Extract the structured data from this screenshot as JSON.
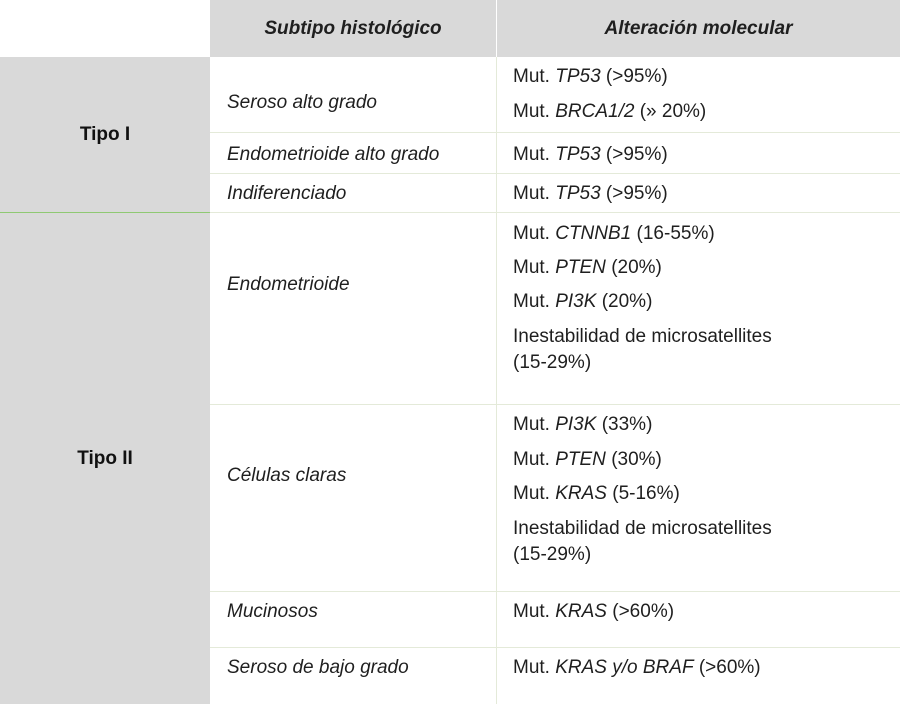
{
  "header": {
    "col_subtype": "Subtipo histológico",
    "col_alteration": "Alteración molecular"
  },
  "groups": [
    {
      "label": "Tipo I",
      "rows": [
        {
          "subtype": "Seroso alto grado",
          "alterations": [
            {
              "prefix": "Mut. ",
              "gene": "TP53",
              "suffix": " (>95%)"
            },
            {
              "prefix": "Mut. ",
              "gene": "BRCA1/2",
              "suffix": " (» 20%)"
            }
          ]
        },
        {
          "subtype": "Endometrioide alto grado",
          "alterations": [
            {
              "prefix": "Mut. ",
              "gene": "TP53",
              "suffix": " (>95%)"
            }
          ]
        },
        {
          "subtype": "Indiferenciado",
          "alterations": [
            {
              "prefix": "Mut. ",
              "gene": "TP53",
              "suffix": " (>95%)"
            }
          ]
        }
      ]
    },
    {
      "label": "Tipo II",
      "rows": [
        {
          "subtype": "Endometrioide",
          "alterations": [
            {
              "prefix": "Mut. ",
              "gene": "CTNNB1",
              "suffix": " (16-55%)"
            },
            {
              "prefix": "Mut. ",
              "gene": "PTEN",
              "suffix": " (20%)"
            },
            {
              "prefix": "Mut. ",
              "gene": "PI3K",
              "suffix": " (20%)"
            },
            {
              "text_line1": "Inestabilidad de microsatellites",
              "text_line2": "(15-29%)"
            }
          ]
        },
        {
          "subtype": "Células claras",
          "alterations": [
            {
              "prefix": "Mut. ",
              "gene": "PI3K",
              "suffix": " (33%)"
            },
            {
              "prefix": "Mut. ",
              "gene": "PTEN",
              "suffix": " (30%)"
            },
            {
              "prefix": "Mut. ",
              "gene": "KRAS",
              "suffix": " (5-16%)"
            },
            {
              "text_line1": "Inestabilidad de microsatellites",
              "text_line2": "(15-29%)"
            }
          ]
        },
        {
          "subtype": "Mucinosos",
          "alterations": [
            {
              "prefix": "Mut. ",
              "gene": "KRAS",
              "suffix": " (>60%)"
            }
          ]
        },
        {
          "subtype": "Seroso de bajo grado",
          "alterations": [
            {
              "prefix": "Mut. ",
              "gene": "KRAS y/o BRAF",
              "suffix": " (>60%)"
            }
          ]
        }
      ]
    }
  ]
}
